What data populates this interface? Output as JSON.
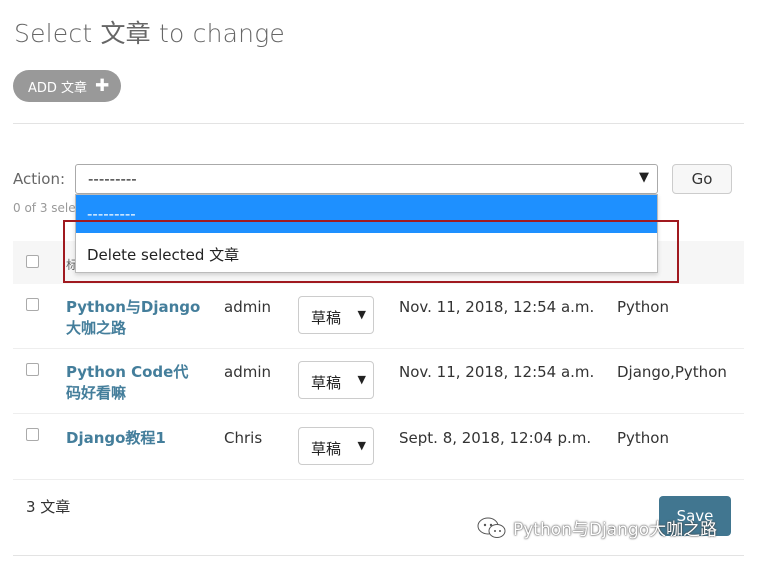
{
  "page": {
    "title": "Select 文章 to change",
    "add_button": "ADD 文章"
  },
  "actions": {
    "label": "Action:",
    "selected": "---------",
    "go_label": "Go",
    "counter": "0 of 3 sele",
    "options": [
      "---------",
      "Delete selected 文章"
    ]
  },
  "table": {
    "header_fragment": "标",
    "rows": [
      {
        "title_l1": "Python与Django",
        "title_l2": "大咖之路",
        "author": "admin",
        "status": "草稿",
        "date": "Nov. 11, 2018, 12:54 a.m.",
        "tags": "Python"
      },
      {
        "title_l1": "Python Code代",
        "title_l2": "码好看嘛",
        "author": "admin",
        "status": "草稿",
        "date": "Nov. 11, 2018, 12:54 a.m.",
        "tags": "Django,Python"
      },
      {
        "title_l1": "Django教程1",
        "title_l2": "",
        "author": "Chris",
        "status": "草稿",
        "date": "Sept. 8, 2018, 12:04 p.m.",
        "tags": "Python"
      }
    ]
  },
  "footer": {
    "total": "3 文章",
    "save_label": "Save"
  },
  "watermark": {
    "text": "Python与Django大咖之路"
  },
  "colors": {
    "link": "#447e9b",
    "save": "#417690",
    "dropdown_highlight": "#1e90ff",
    "callout": "#a0191f"
  }
}
